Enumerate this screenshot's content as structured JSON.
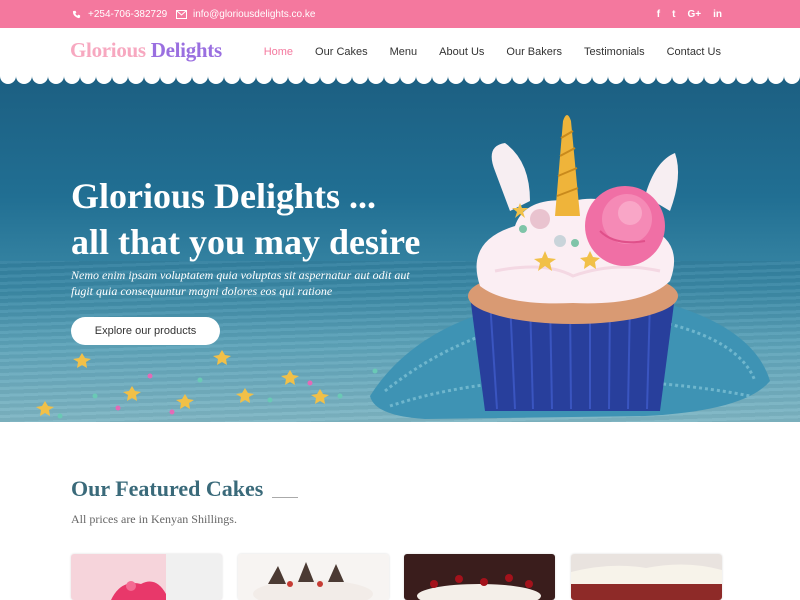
{
  "topbar": {
    "phone": "+254-706-382729",
    "email": "info@gloriousdelights.co.ke",
    "phone_icon": "phone-icon",
    "email_icon": "envelope-icon",
    "social": [
      {
        "icon": "facebook-icon",
        "glyph": "f"
      },
      {
        "icon": "twitter-icon",
        "glyph": "t"
      },
      {
        "icon": "google-plus-icon",
        "glyph": "G+"
      },
      {
        "icon": "linkedin-icon",
        "glyph": "in"
      }
    ]
  },
  "brand": {
    "part1": "Glorious",
    "part2": "Delights",
    "color1": "#f7a8c0",
    "color2": "#9a6fe0"
  },
  "nav": {
    "items": [
      "Home",
      "Our Cakes",
      "Menu",
      "About Us",
      "Our Bakers",
      "Testimonials",
      "Contact Us"
    ],
    "active": "Home",
    "accent": "#f4789e"
  },
  "hero": {
    "title_line1": "Glorious Delights ...",
    "title_line2": "all that you may desire",
    "subtitle_line1": "Nemo enim ipsam voluptatem quia voluptas sit aspernatur aut odit aut",
    "subtitle_line2": "fugit quia consequuntur magni dolores eos qui ratione",
    "cta": "Explore our products"
  },
  "featured": {
    "title": "Our Featured Cakes",
    "note": "All prices are in Kenyan Shillings."
  }
}
